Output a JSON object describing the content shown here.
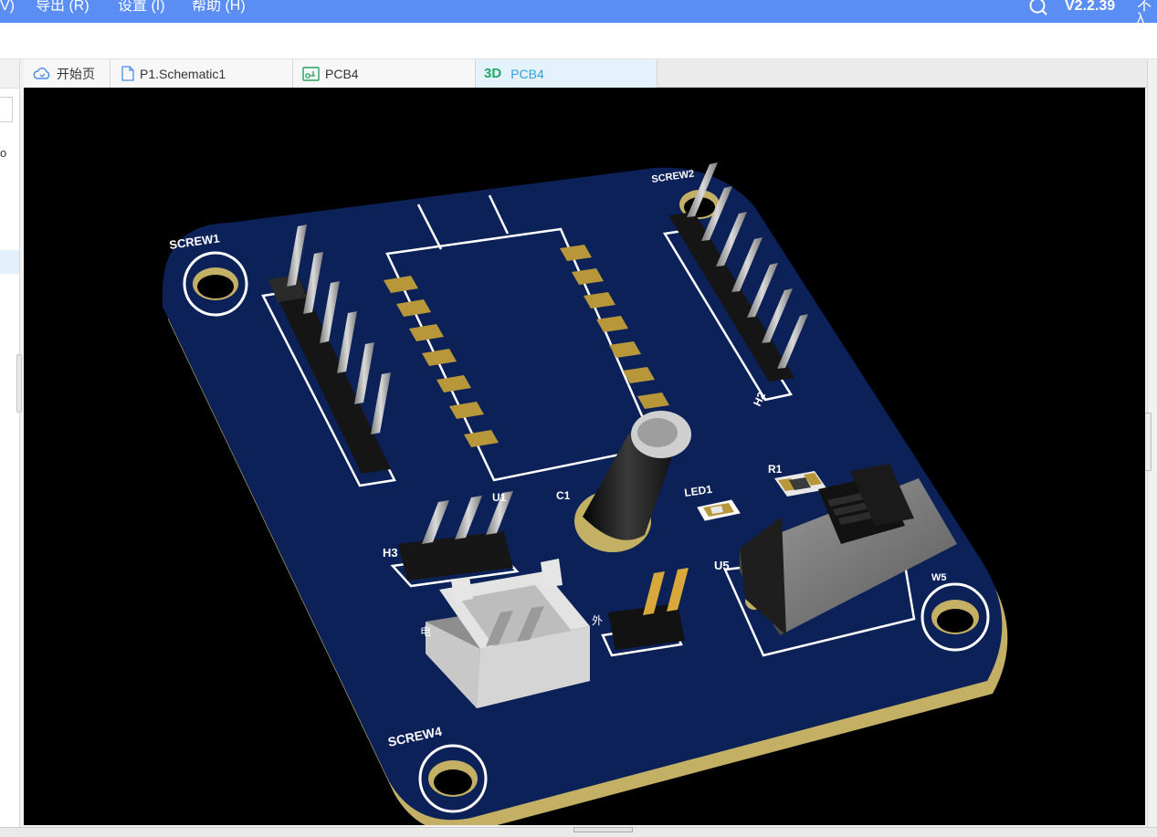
{
  "menubar": {
    "items": [
      {
        "label": "V)"
      },
      {
        "label": "导出 (R)"
      },
      {
        "label": "设置 (I)"
      },
      {
        "label": "帮助 (H)"
      }
    ],
    "version": "V2.2.39",
    "truncated": "不λ"
  },
  "left_panel": {
    "fragment": "o"
  },
  "tabs": [
    {
      "label": "开始页",
      "icon": "cloud-icon"
    },
    {
      "label": "P1.Schematic1",
      "icon": "document-icon"
    },
    {
      "label": "PCB4",
      "icon": "pcb-icon"
    },
    {
      "label": "PCB4",
      "icon": "3d-icon",
      "mark": "3D",
      "active": true
    }
  ],
  "viewport": {
    "silkscreen": {
      "screw1": "SCREW1",
      "screw2": "SCREW2",
      "screw4": "SCREW4",
      "screw5": "W5",
      "h2": "H2",
      "h3": "H3",
      "u1": "U1",
      "c1": "C1",
      "led1": "LED1",
      "r1": "R1",
      "u5": "U5",
      "dian": "电",
      "wai": "外"
    },
    "colors": {
      "board": "#0c2158",
      "silkscreen": "#ffffff",
      "pad": "#b8973a",
      "board_edge": "#c4b064"
    }
  }
}
